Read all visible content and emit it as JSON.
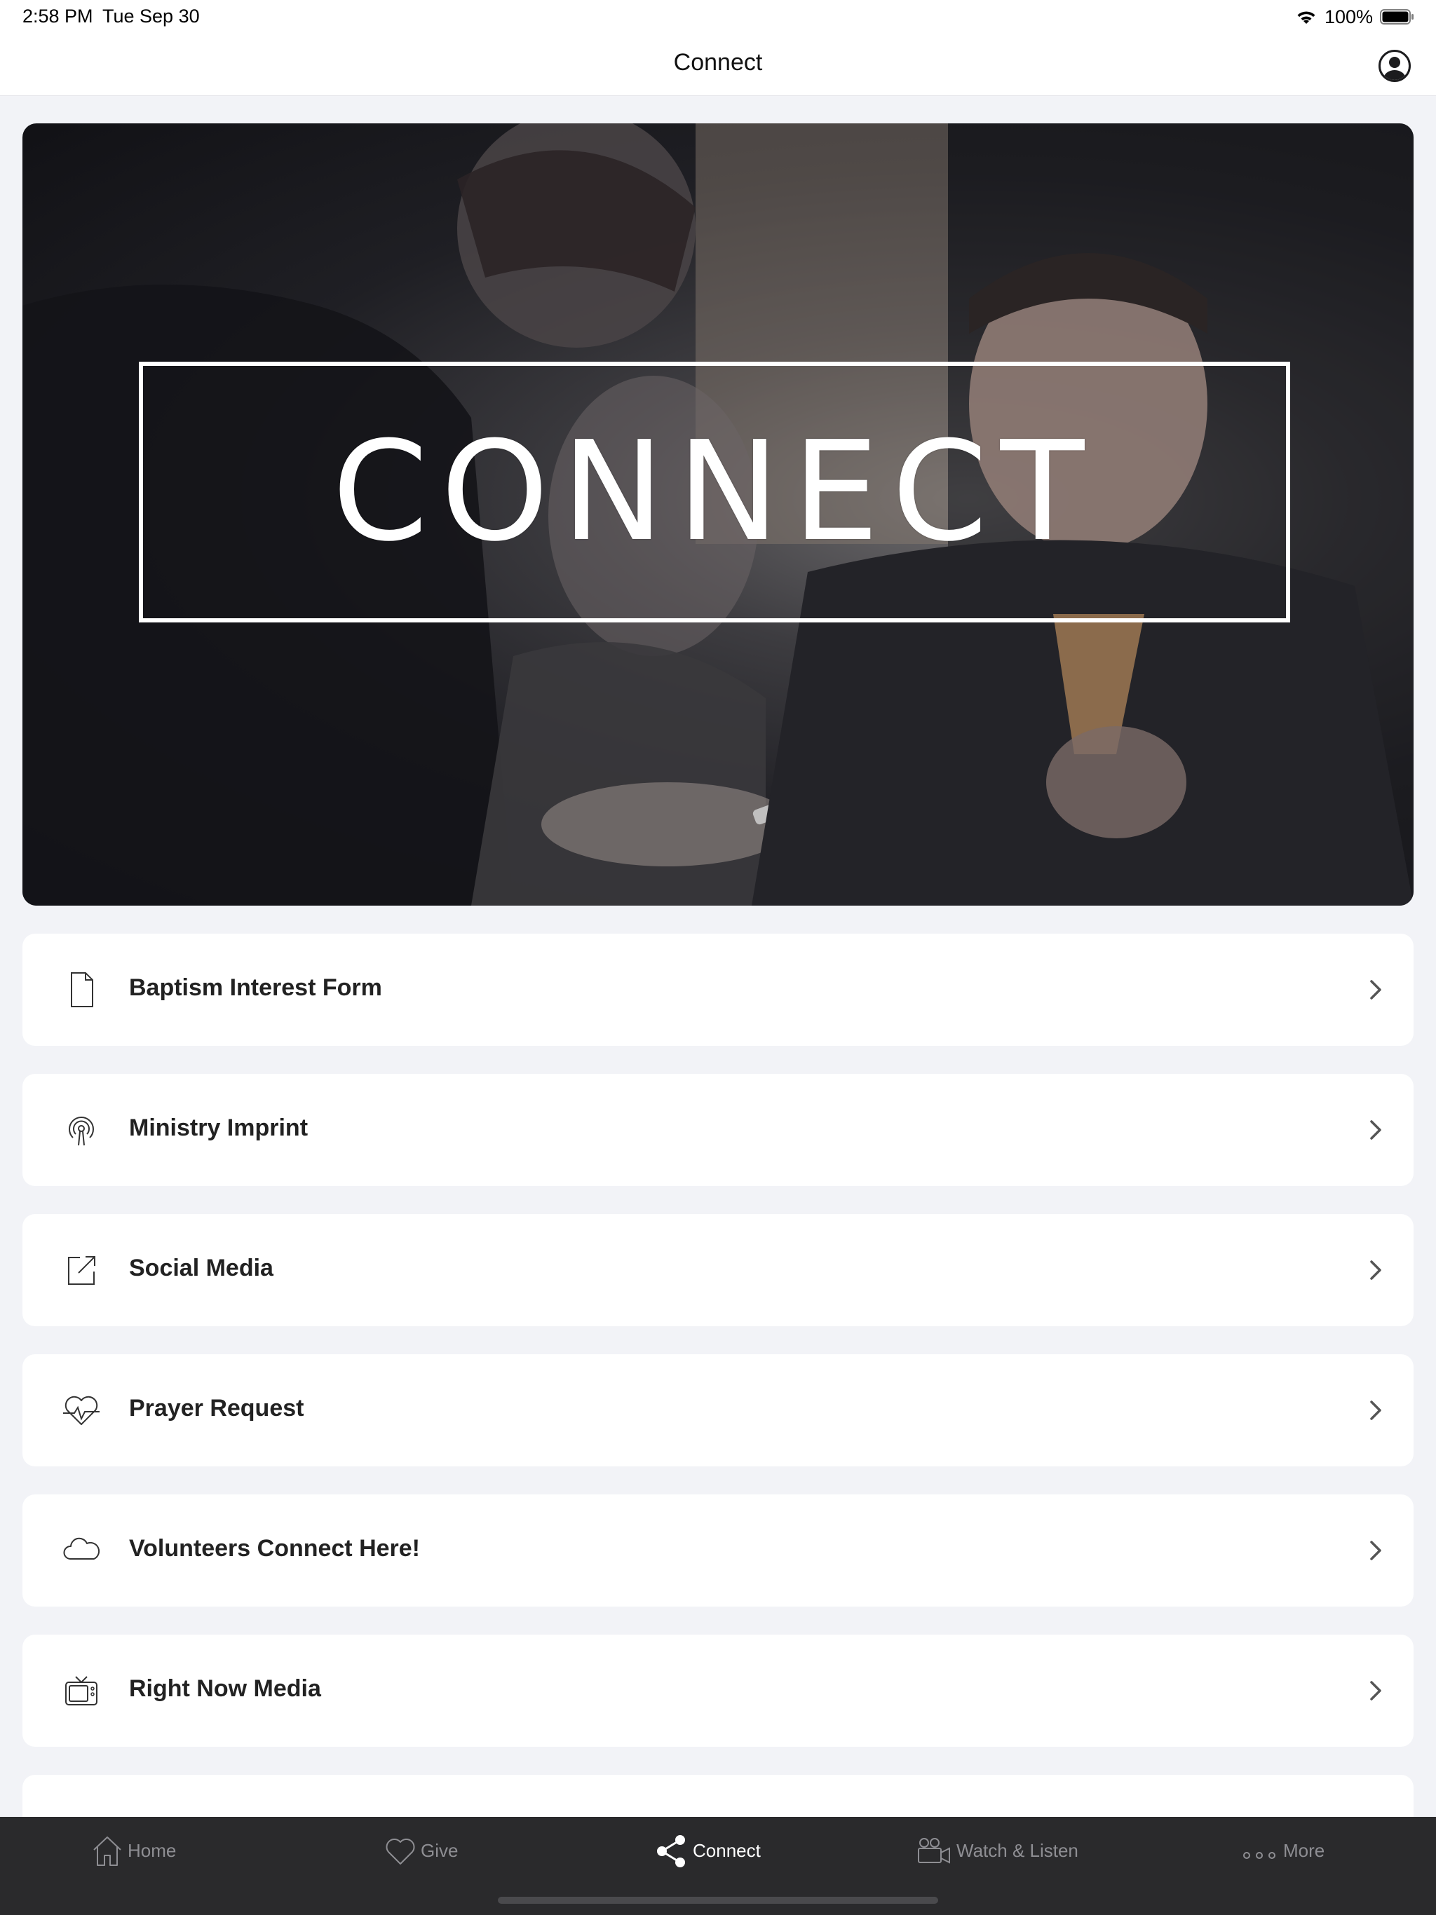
{
  "status_bar": {
    "time": "2:58 PM",
    "date": "Tue Sep 30",
    "battery": "100%"
  },
  "nav": {
    "title": "Connect"
  },
  "hero": {
    "text": "CONNECT"
  },
  "menu_items": [
    {
      "label": "Baptism Interest Form",
      "icon": "document-icon"
    },
    {
      "label": "Ministry Imprint",
      "icon": "broadcast-icon"
    },
    {
      "label": "Social Media",
      "icon": "external-link-icon"
    },
    {
      "label": "Prayer Request",
      "icon": "heart-pulse-icon"
    },
    {
      "label": "Volunteers Connect Here!",
      "icon": "cloud-icon"
    },
    {
      "label": "Right Now Media",
      "icon": "tv-icon"
    }
  ],
  "tabs": [
    {
      "label": "Home",
      "icon": "home-icon",
      "active": false
    },
    {
      "label": "Give",
      "icon": "heart-icon",
      "active": false
    },
    {
      "label": "Connect",
      "icon": "share-icon",
      "active": true
    },
    {
      "label": "Watch & Listen",
      "icon": "video-camera-icon",
      "active": false
    },
    {
      "label": "More",
      "icon": "more-dots-icon",
      "active": false
    }
  ],
  "colors": {
    "tab_bar": "#2a2a2c",
    "active_tab": "#ffffff",
    "inactive_tab": "#8e8e93",
    "background": "#f2f3f7"
  }
}
